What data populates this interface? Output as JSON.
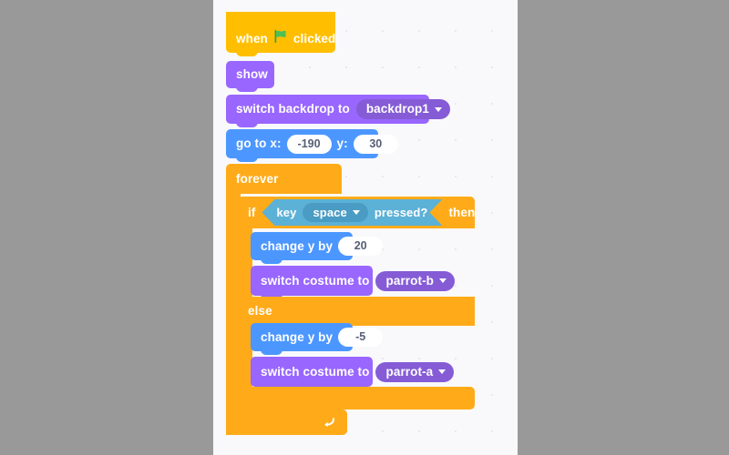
{
  "workspace": {
    "background_color": "#f9f9fb",
    "page_background_color": "#999999",
    "grid": "dot-grid"
  },
  "palette": {
    "events": "#ffbf00",
    "looks": "#9966ff",
    "looks_dropdown": "#855cd6",
    "motion": "#4c97ff",
    "control": "#ffab19",
    "sensing": "#5cb1d6",
    "sensing_dropdown": "#4a9cc4",
    "input_field": "#ffffff",
    "input_text": "#575e75",
    "flag_green": "#4cbf56"
  },
  "script": {
    "hat": {
      "word_when": "when",
      "icon": "green-flag-icon",
      "word_clicked": "clicked"
    },
    "show": {
      "label": "show"
    },
    "switch_backdrop": {
      "label": "switch backdrop to",
      "value": "backdrop1",
      "caret": "chevron-down-icon"
    },
    "goto": {
      "label_x": "go to x:",
      "value_x": "-190",
      "label_y": "y:",
      "value_y": "30"
    },
    "forever": {
      "label": "forever",
      "loop_icon": "loop-arrow-icon"
    },
    "if_else": {
      "word_if": "if",
      "word_then": "then",
      "word_else": "else",
      "condition": {
        "word_key": "key",
        "key_value": "space",
        "word_pressed": "pressed?",
        "caret": "chevron-down-icon"
      },
      "then_branch": [
        {
          "type": "motion",
          "label": "change y by",
          "value": "20"
        },
        {
          "type": "looks",
          "label": "switch costume to",
          "value": "parrot-b",
          "caret": "chevron-down-icon"
        }
      ],
      "else_branch": [
        {
          "type": "motion",
          "label": "change y by",
          "value": "-5"
        },
        {
          "type": "looks",
          "label": "switch costume to",
          "value": "parrot-a",
          "caret": "chevron-down-icon"
        }
      ]
    }
  }
}
